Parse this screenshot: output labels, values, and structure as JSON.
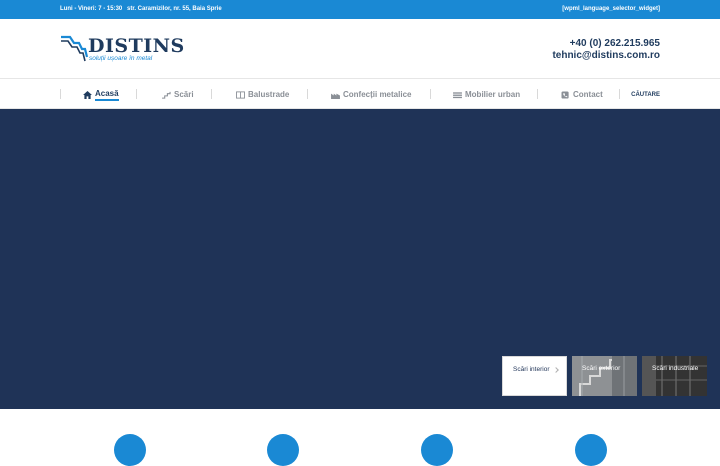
{
  "topbar": {
    "hours": "Luni - Vineri: 7 - 15:30",
    "address": "str. Caramizilor, nr. 55, Baia Sprie",
    "language_widget": "[wpml_language_selector_widget]"
  },
  "header": {
    "logo_name": "DISTINS",
    "logo_tagline": "soluții ușoare în metal",
    "phone": "+40 (0) 262.215.965",
    "email": "tehnic@distins.com.ro"
  },
  "nav": {
    "items": [
      {
        "label": "Acasă",
        "icon": "home-icon",
        "active": true
      },
      {
        "label": "Scări",
        "icon": "stairs-icon",
        "active": false
      },
      {
        "label": "Balustrade",
        "icon": "railing-icon",
        "active": false
      },
      {
        "label": "Confecții metalice",
        "icon": "factory-icon",
        "active": false
      },
      {
        "label": "Mobilier urban",
        "icon": "bench-icon",
        "active": false
      },
      {
        "label": "Contact",
        "icon": "phone-icon",
        "active": false
      }
    ],
    "search_label": "CĂUTARE"
  },
  "hero": {
    "slides": [
      {
        "label": "Scări interior"
      },
      {
        "label": "Scări exterior"
      },
      {
        "label": "Scări industriale"
      }
    ]
  },
  "colors": {
    "accent": "#1a89d4",
    "dark_navy": "#1f3357",
    "text_dark": "#1f3b5e"
  }
}
